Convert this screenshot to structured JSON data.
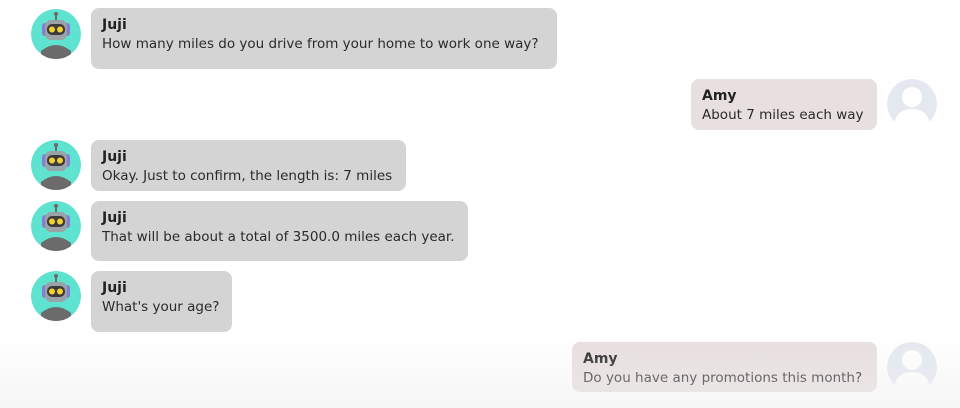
{
  "chat": {
    "bot_name": "Juji",
    "user_name": "Amy",
    "colors": {
      "bot_bubble": "#d4d4d4",
      "user_bubble": "#e8dfdf",
      "bot_avatar_bg": "#5ee3d0",
      "user_avatar_bg": "#e5e8f0"
    },
    "avatar_icons": {
      "bot": "robot-icon",
      "user": "person-silhouette-icon"
    },
    "messages": [
      {
        "sender": "Juji",
        "text": "How many miles do you drive from your home to work one way?"
      },
      {
        "sender": "Amy",
        "text": "About 7 miles each way"
      },
      {
        "sender": "Juji",
        "text": "Okay. Just to confirm, the length is: 7 miles"
      },
      {
        "sender": "Juji",
        "text": "That will be about a total of 3500.0 miles each year."
      },
      {
        "sender": "Juji",
        "text": "What's your age?"
      },
      {
        "sender": "Amy",
        "text": "Do you have any promotions this month?"
      }
    ]
  }
}
